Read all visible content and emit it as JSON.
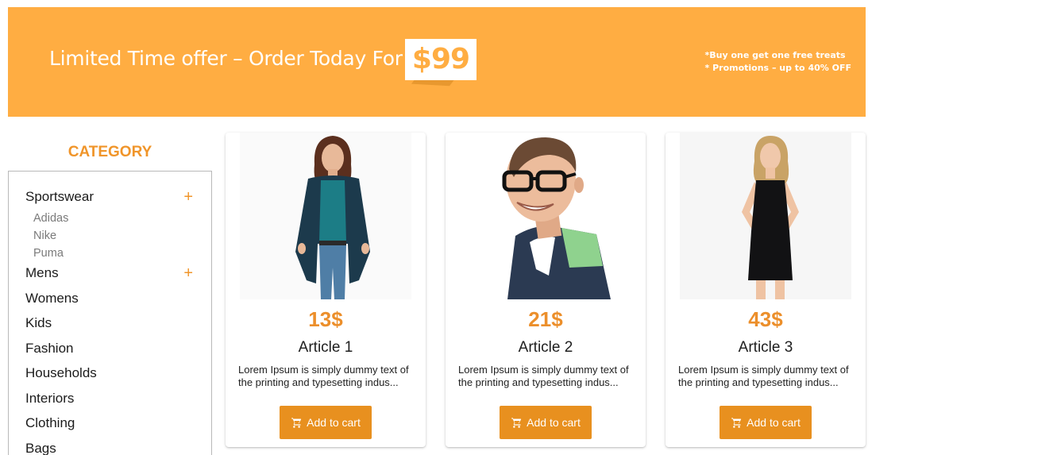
{
  "banner": {
    "headline": "Limited Time offer – Order Today For",
    "price": "$99",
    "note_1": "*Buy one get one free treats",
    "note_2": "* Promotions – up to 40% OFF"
  },
  "sidebar": {
    "title": "CATEGORY",
    "categories": [
      {
        "label": "Sportswear",
        "expand_icon": "plus-icon",
        "sub": [
          "Adidas",
          "Nike",
          "Puma"
        ]
      },
      {
        "label": "Mens",
        "expand_icon": "plus-icon"
      },
      {
        "label": "Womens"
      },
      {
        "label": "Kids"
      },
      {
        "label": "Fashion"
      },
      {
        "label": "Households"
      },
      {
        "label": "Interiors"
      },
      {
        "label": "Clothing"
      },
      {
        "label": "Bags"
      }
    ],
    "plus_symbol": "+"
  },
  "products": [
    {
      "price": "13$",
      "title": "Article 1",
      "description": "Lorem Ipsum is simply dummy text of the printing and typesetting indus...",
      "button_label": "Add to cart",
      "image": "woman-in-cardigan-photo"
    },
    {
      "price": "21$",
      "title": "Article 2",
      "description": "Lorem Ipsum is simply dummy text of the printing and typesetting indus...",
      "button_label": "Add to cart",
      "image": "man-with-glasses-photo"
    },
    {
      "price": "43$",
      "title": "Article 3",
      "description": "Lorem Ipsum is simply dummy text of the printing and typesetting indus...",
      "button_label": "Add to cart",
      "image": "woman-in-black-dress-photo"
    }
  ],
  "colors": {
    "banner": "#ffad42",
    "accent": "#f0952a",
    "button": "#e8901f"
  }
}
